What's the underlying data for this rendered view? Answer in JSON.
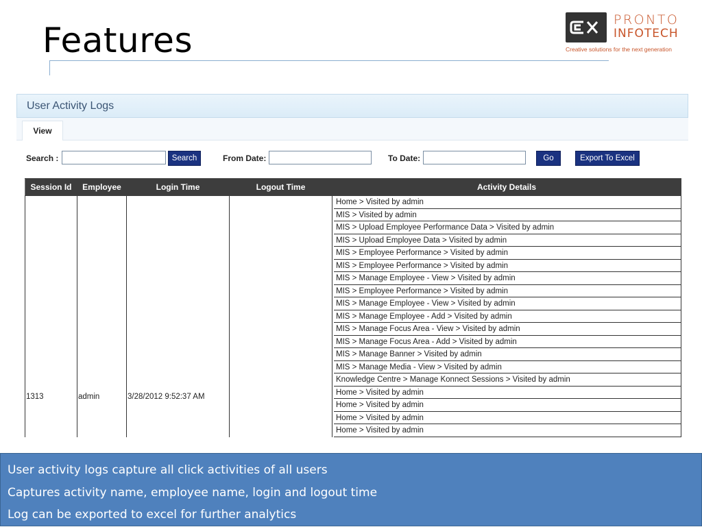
{
  "slide": {
    "title": "Features",
    "logo": {
      "line1": "PRONTO",
      "line2": "INFOTECH",
      "tagline": "Creative solutions for the next generation"
    }
  },
  "app": {
    "panel_title": "User Activity Logs",
    "tabs": [
      {
        "label": "View"
      }
    ],
    "filters": {
      "search_label": "Search :",
      "search_value": "",
      "search_button": "Search",
      "from_label": "From Date:",
      "from_value": "",
      "to_label": "To Date:",
      "to_value": "",
      "go_button": "Go",
      "export_button": "Export To Excel"
    },
    "table": {
      "headers": [
        "Session Id",
        "Employee",
        "Login Time",
        "Logout Time",
        "Activity Details"
      ],
      "row": {
        "session_id": "1313",
        "employee": "admin",
        "login_time": "3/28/2012 9:52:37 AM",
        "logout_time": "",
        "activities": [
          "Home > Visited by admin",
          "MIS > Visited by admin",
          "MIS > Upload Employee Performance Data > Visited by admin",
          "MIS > Upload Employee Data > Visited by admin",
          "MIS > Employee Performance > Visited by admin",
          "MIS > Employee Performance > Visited by admin",
          "MIS > Manage Employee - View > Visited by admin",
          "MIS > Employee Performance > Visited by admin",
          "MIS > Manage Employee - View > Visited by admin",
          "MIS > Manage Employee - Add > Visited by admin",
          "MIS > Manage Focus Area - View > Visited by admin",
          "MIS > Manage Focus Area - Add > Visited by admin",
          "MIS > Manage Banner > Visited by admin",
          "MIS > Manage Media - View > Visited by admin",
          "Knowledge Centre > Manage Konnect Sessions > Visited by admin",
          "Home > Visited by admin",
          "Home > Visited by admin",
          "Home > Visited by admin",
          "Home > Visited by admin"
        ]
      }
    }
  },
  "bullets": [
    "User activity logs capture all click activities of all users",
    "Captures activity name, employee name, login and logout time",
    "Log can be exported to excel for further analytics"
  ],
  "colors": {
    "bullet_box": "#4f81bd",
    "button": "#1a3280",
    "table_header": "#3d3d3d",
    "logo_accent": "#c8552a"
  }
}
